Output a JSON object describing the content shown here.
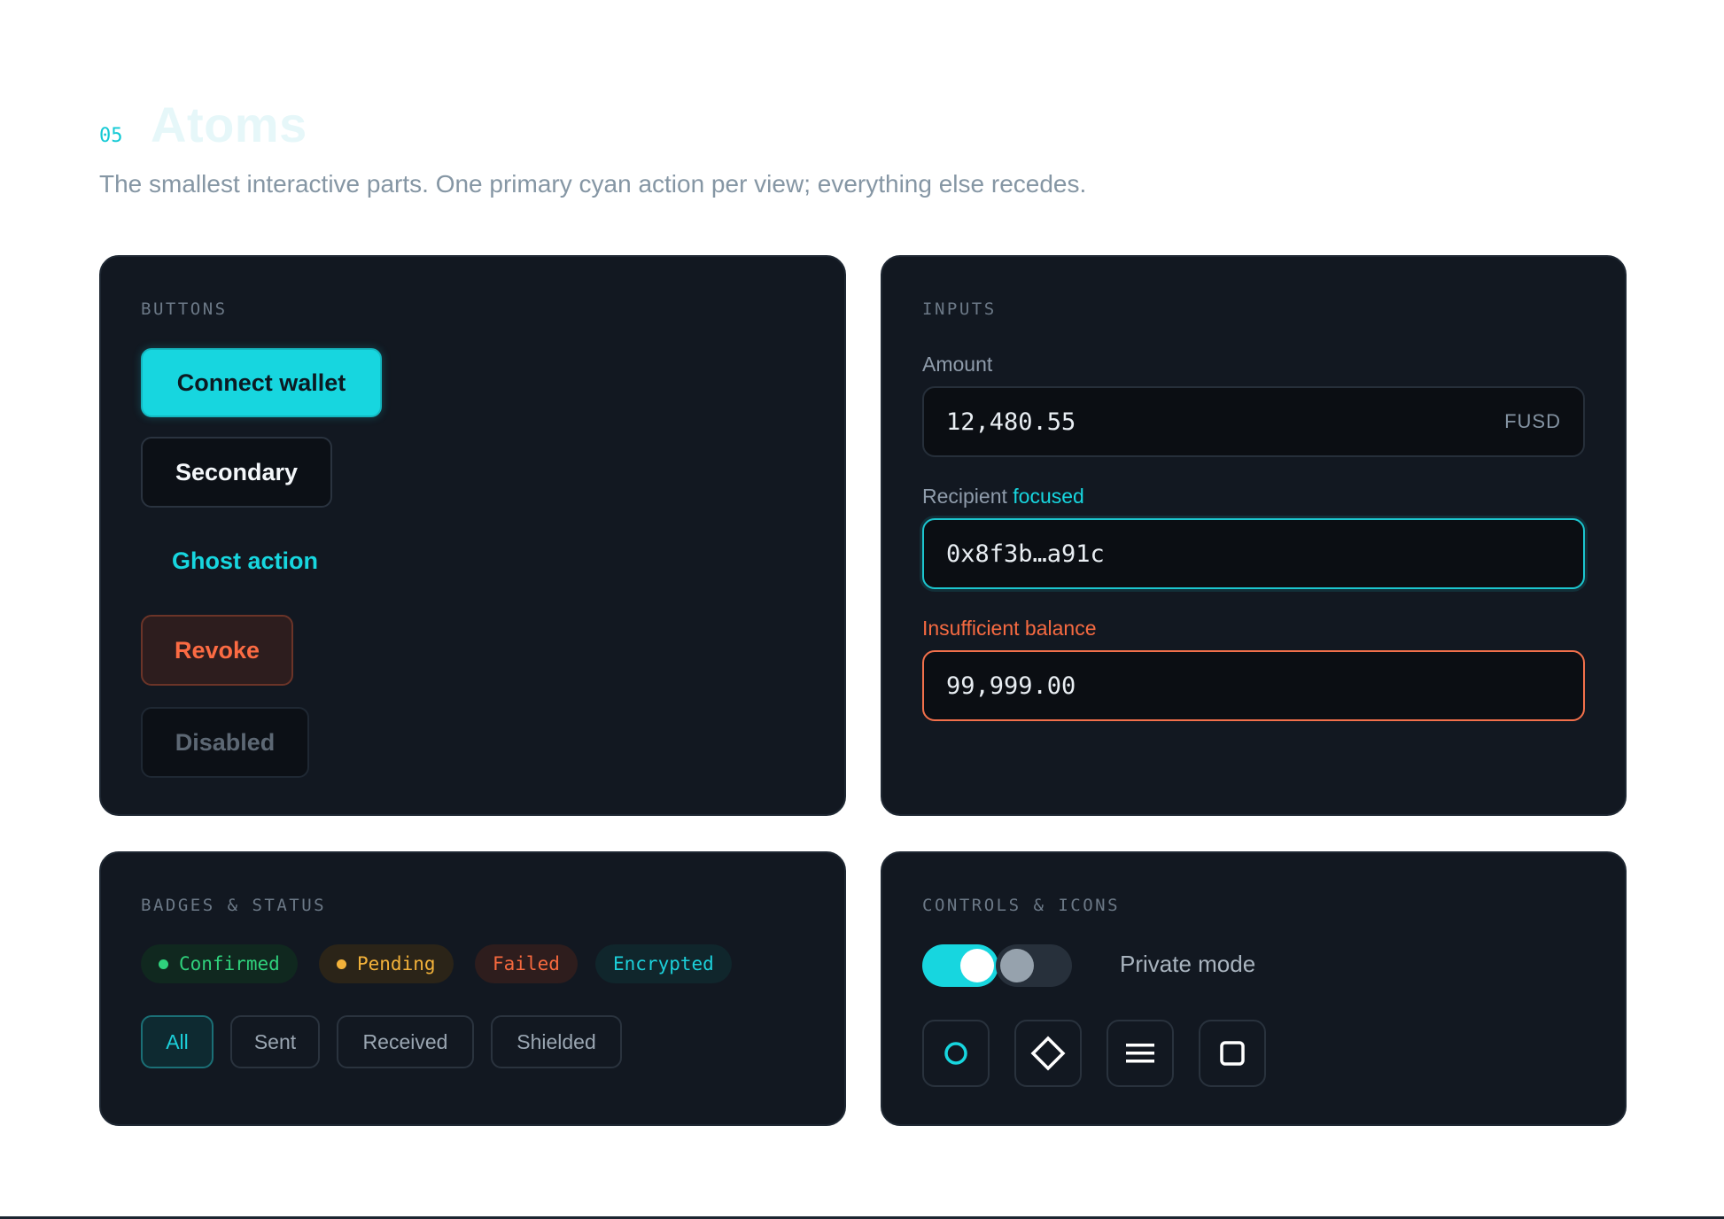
{
  "header": {
    "section_number": "05",
    "title": "Atoms",
    "subtitle": "The smallest interactive parts. One primary cyan action per view; everything else recedes."
  },
  "buttons_card": {
    "label": "BUTTONS",
    "primary": "Connect wallet",
    "secondary": "Secondary",
    "ghost": "Ghost action",
    "danger": "Revoke",
    "disabled": "Disabled"
  },
  "inputs_card": {
    "label": "INPUTS",
    "amount": {
      "label": "Amount",
      "value": "12,480.55",
      "suffix": "FUSD"
    },
    "recipient": {
      "label": "Recipient",
      "state": "focused",
      "value": "0x8f3b…a91c"
    },
    "error": {
      "label": "Insufficient balance",
      "value": "99,999.00"
    }
  },
  "badges_card": {
    "label": "BADGES & STATUS",
    "badges": [
      "Confirmed",
      "Pending",
      "Failed",
      "Encrypted"
    ],
    "filters": [
      "All",
      "Sent",
      "Received",
      "Shielded"
    ],
    "active_filter": "All"
  },
  "controls_card": {
    "label": "CONTROLS & ICONS",
    "toggle_on": true,
    "toggle_off": false,
    "toggle_label": "Private mode",
    "icons": [
      "circle-icon",
      "diamond-icon",
      "menu-icon",
      "square-icon"
    ]
  },
  "colors": {
    "accent": "#17d6df",
    "danger": "#f6693e",
    "success": "#2fd17c",
    "warning": "#f3b23a",
    "card_bg": "#121821"
  }
}
